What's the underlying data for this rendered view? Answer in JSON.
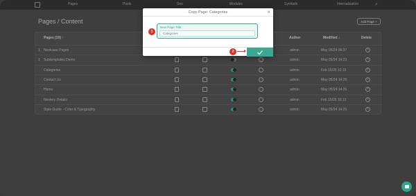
{
  "nav": {
    "items": [
      "Pages",
      "Posts",
      "Seo",
      "Modules",
      "Symbols",
      "Internalization"
    ]
  },
  "page_title": "Pages / Content",
  "add_page_label": "Add Page +",
  "table": {
    "headers": {
      "pages": "Pages (10)",
      "author": "Author",
      "modified": "Modified",
      "delete": "Delete"
    },
    "rows": [
      {
        "num": "1",
        "title": "Nextcase Pages",
        "author": "admin",
        "modified": "May 05/24 06:37",
        "published": true
      },
      {
        "num": "1",
        "title": "Subtemplates Demo",
        "author": "admin",
        "modified": "May 05/24 14:23",
        "published": false
      },
      {
        "num": "",
        "title": "Categories",
        "author": "admin",
        "modified": "Feb 15/25 10:16",
        "published": true
      },
      {
        "num": "",
        "title": "Contact Us",
        "author": "admin",
        "modified": "May 05/24 14:26",
        "published": true
      },
      {
        "num": "",
        "title": "Home",
        "author": "admin",
        "modified": "May 05/24 14:26",
        "published": true
      },
      {
        "num": "",
        "title": "Nestery Details",
        "author": "admin",
        "modified": "Feb 15/25 10:13",
        "published": true
      },
      {
        "num": "",
        "title": "Style Guide - Color & Typography",
        "author": "admin",
        "modified": "May 05/24 14:26",
        "published": true
      }
    ]
  },
  "modal": {
    "title": "Copy Page: Categories",
    "field_label": "New Page Title:",
    "field_value": "Categories",
    "markers": [
      "1",
      "2"
    ]
  },
  "colors": {
    "accent": "#3aa893",
    "marker": "#d9342b"
  }
}
